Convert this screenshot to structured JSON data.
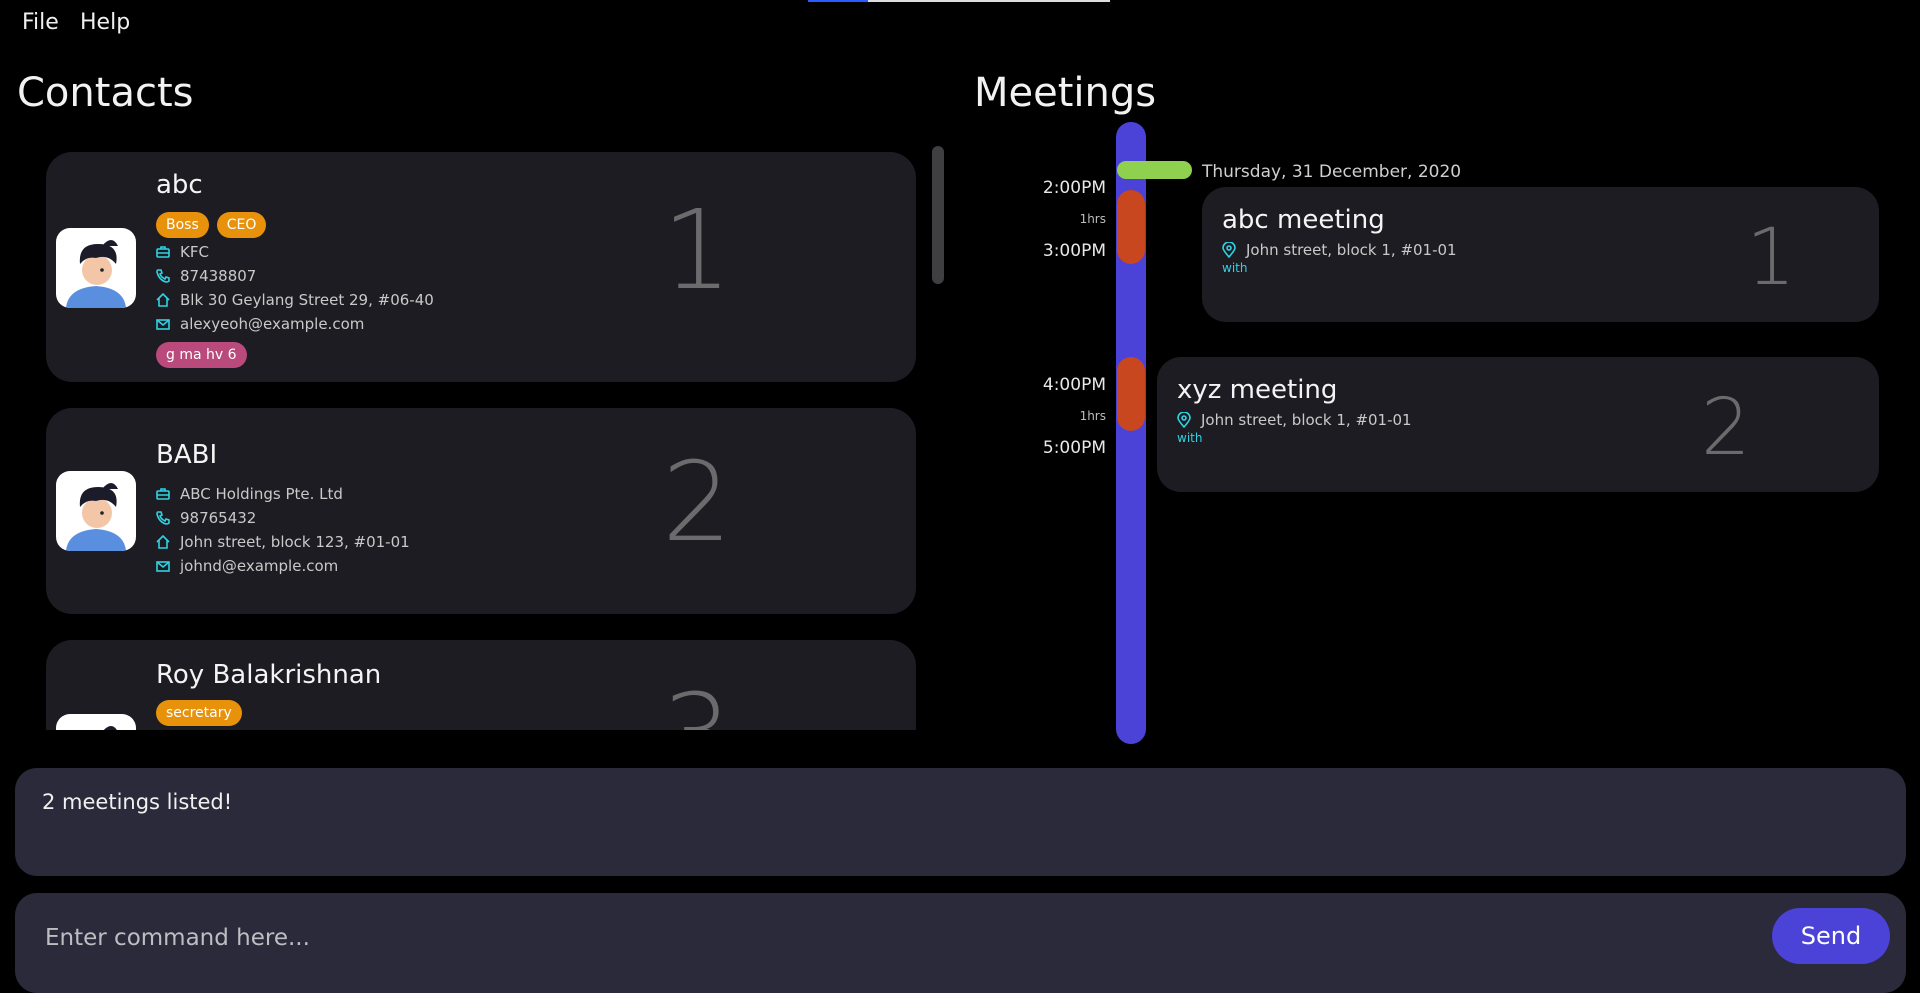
{
  "menu": {
    "file": "File",
    "help": "Help"
  },
  "contacts": {
    "title": "Contacts",
    "items": [
      {
        "name": "abc",
        "tags": [
          "Boss",
          "CEO"
        ],
        "company": "KFC",
        "phone": "87438807",
        "address": "Blk 30 Geylang Street 29, #06-40",
        "email": "alexyeoh@example.com",
        "remark": "g ma hv 6",
        "index": "1"
      },
      {
        "name": "BABI",
        "company": "ABC Holdings Pte. Ltd",
        "phone": "98765432",
        "address": "John street, block 123, #01-01",
        "email": "johnd@example.com",
        "index": "2"
      },
      {
        "name": "Roy Balakrishnan",
        "tags": [
          "secretary"
        ],
        "index": "3"
      }
    ]
  },
  "meetings": {
    "title": "Meetings",
    "date": "Thursday, 31 December, 2020",
    "times": [
      "2:00PM",
      "3:00PM",
      "4:00PM",
      "5:00PM"
    ],
    "durations": [
      "1hrs",
      "1hrs"
    ],
    "items": [
      {
        "title": "abc meeting",
        "location": "John street, block 1, #01-01",
        "with": "with",
        "index": "1"
      },
      {
        "title": "xyz meeting",
        "location": "John street, block 1, #01-01",
        "with": "with",
        "index": "2"
      }
    ]
  },
  "result": {
    "text": "2 meetings listed!"
  },
  "command": {
    "placeholder": "Enter command here...",
    "send_label": "Send"
  },
  "colors": {
    "accent": "#4b42d8",
    "tag_orange": "#e8920c",
    "tag_pink": "#b94a7b",
    "meeting_block": "#c8471e",
    "date_marker": "#8fd14f",
    "icon_cyan": "#2fd3e3"
  }
}
